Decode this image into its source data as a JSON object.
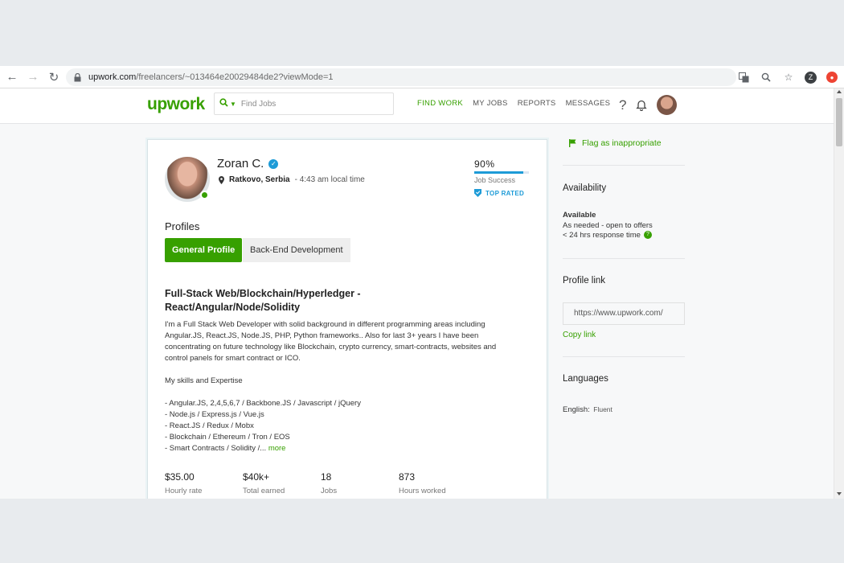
{
  "browser": {
    "url_host": "upwork.com",
    "url_path": "/freelancers/~013464e20029484de2?viewMode=1",
    "profile_initial": "Z"
  },
  "header": {
    "logo": "upwork",
    "search_placeholder": "Find Jobs",
    "nav": [
      "FIND WORK",
      "MY JOBS",
      "REPORTS",
      "MESSAGES"
    ],
    "help": "?"
  },
  "profile": {
    "name": "Zoran C.",
    "location": "Ratkovo, Serbia",
    "local_time": "- 4:43 am local time",
    "job_success_value": "90%",
    "job_success_fraction": 0.9,
    "job_success_label": "Job Success",
    "top_rated": "TOP RATED",
    "profiles_label": "Profiles",
    "tabs": [
      "General Profile",
      "Back-End Development"
    ],
    "headline": "Full-Stack Web/Blockchain/Hyperledger - React/Angular/Node/Solidity",
    "overview": "I'm a Full Stack Web Developer with solid background in different programming areas including Angular.JS, React.JS, Node.JS, PHP, Python frameworks.. Also for last 3+ years I have been concentrating on future technology like Blockchain, crypto currency, smart-contracts, websites and control panels for smart contract or ICO.\n\nMy skills and Expertise\n\n- Angular.JS, 2,4,5,6,7 / Backbone.JS / Javascript / jQuery\n- Node.js / Express.js / Vue.js\n- React.JS / Redux / Mobx\n- Blockchain / Ethereum / Tron / EOS\n- Smart Contracts / Solidity /... ",
    "more": "more",
    "stats": [
      {
        "value": "$35.00",
        "label": "Hourly rate"
      },
      {
        "value": "$40k+",
        "label": "Total earned"
      },
      {
        "value": "18",
        "label": "Jobs"
      },
      {
        "value": "873",
        "label": "Hours worked"
      }
    ]
  },
  "sidebar": {
    "flag": "Flag as inappropriate",
    "availability_title": "Availability",
    "availability_status": "Available",
    "availability_detail": "As needed - open to offers",
    "response_time": "< 24 hrs response time",
    "profile_link_title": "Profile link",
    "profile_link_value": "https://www.upwork.com/",
    "copy_link": "Copy link",
    "languages_title": "Languages",
    "language_name": "English:",
    "language_level": "Fluent"
  },
  "colors": {
    "brand_green": "#37a000",
    "accent_blue": "#1d9bd7"
  }
}
